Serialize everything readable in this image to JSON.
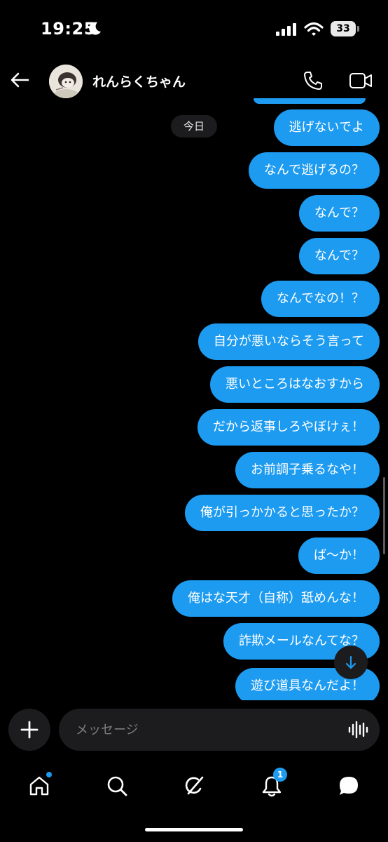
{
  "status_bar": {
    "time": "19:25",
    "battery": "33"
  },
  "header": {
    "contact_name": "れんらくちゃん"
  },
  "chat": {
    "date_separator": "今日",
    "messages": [
      "逃げないでよ",
      "なんで逃げるの？",
      "なんで？",
      "なんで？",
      "なんでなの！？",
      "自分が悪いならそう言って",
      "悪いところはなおすから",
      "だから返事しろやぼけぇ！",
      "お前調子乗るなや！",
      "俺が引っかかると思ったか？",
      "ば〜か！",
      "俺はな天才（自称）舐めんな！",
      "詐欺メールなんてな？",
      "遊び道具なんだよ！"
    ]
  },
  "composer": {
    "placeholder": "メッセージ"
  },
  "nav": {
    "notification_count": "1"
  },
  "colors": {
    "accent": "#1d9bf0",
    "background": "#000000",
    "surface": "#1c1c1e"
  }
}
